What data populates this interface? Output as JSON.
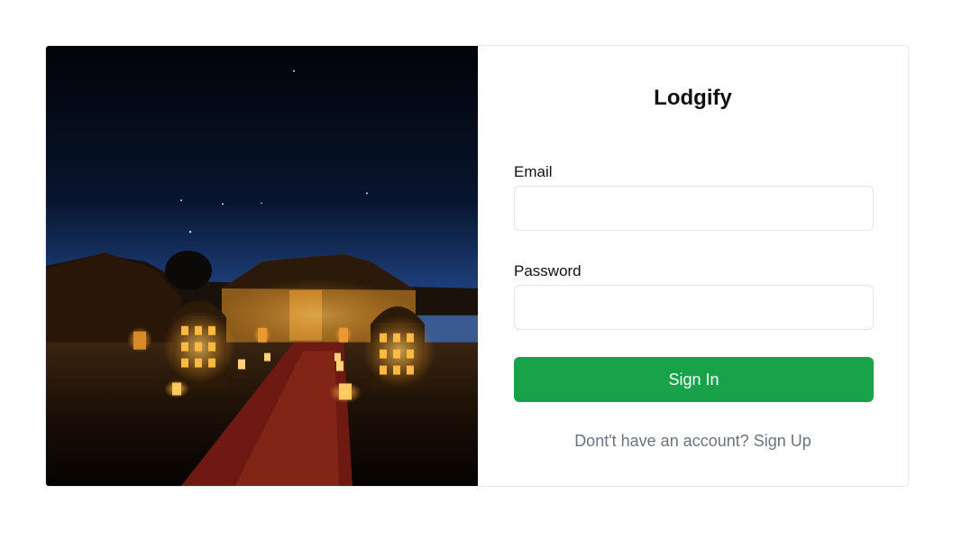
{
  "brand": {
    "title": "Lodgify"
  },
  "form": {
    "email_label": "Email",
    "email_value": "",
    "email_placeholder": "",
    "password_label": "Password",
    "password_value": "",
    "password_placeholder": "",
    "submit_label": "Sign In",
    "signup_text": "Dont't have an account? Sign Up"
  },
  "hero": {
    "image_description_icon": "desert-camp-night-image"
  },
  "colors": {
    "accent": "#18a34a",
    "muted_text": "#6b7280",
    "border": "#e2e4e8"
  }
}
